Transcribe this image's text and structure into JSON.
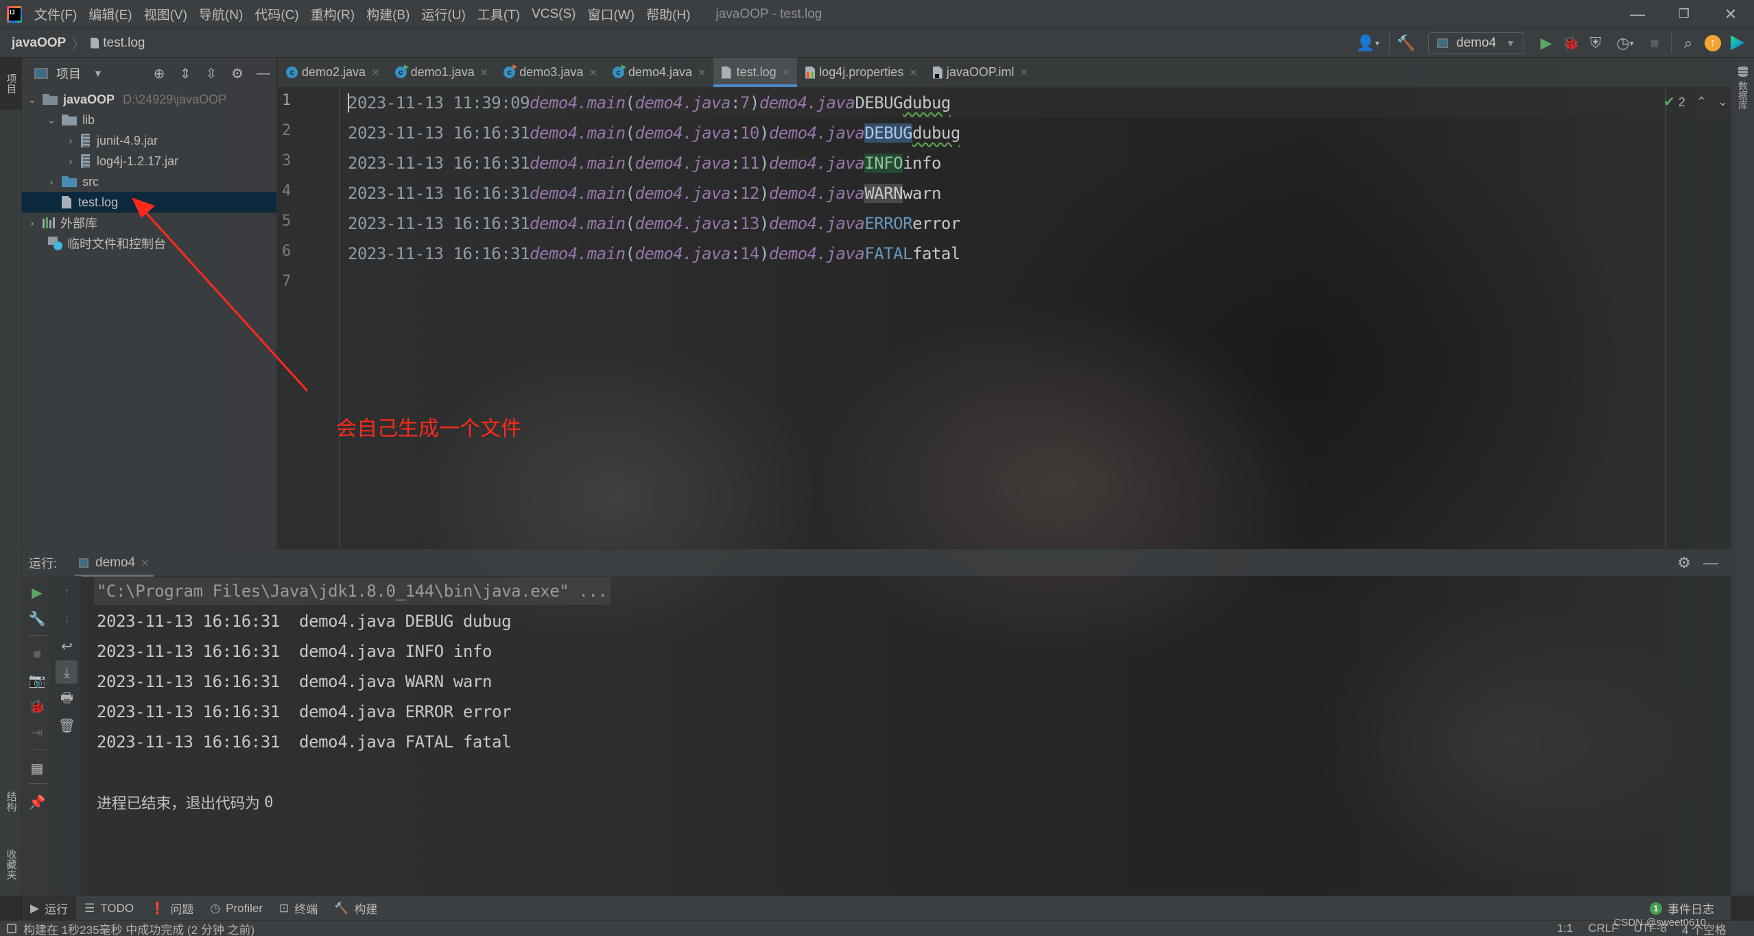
{
  "menubar": {
    "items": [
      "文件(F)",
      "编辑(E)",
      "视图(V)",
      "导航(N)",
      "代码(C)",
      "重构(R)",
      "构建(B)",
      "运行(U)",
      "工具(T)",
      "VCS(S)",
      "窗口(W)",
      "帮助(H)"
    ],
    "window_title": "javaOOP - test.log",
    "controls": {
      "minimize": "—",
      "restore": "❐",
      "close": "✕"
    }
  },
  "navbar": {
    "breadcrumb_root": "javaOOP",
    "breadcrumb_sep": "〉",
    "breadcrumb_file": "test.log",
    "run_config": "demo4",
    "icons": [
      "user-icon",
      "build-hammer-icon",
      "run-icon",
      "debug-icon",
      "coverage-icon",
      "profile-icon",
      "stop-icon",
      "search-icon",
      "update-icon",
      "toolbox-icon"
    ]
  },
  "left_strip": {
    "project_tab": "项目",
    "structure_tab": "结构",
    "favorites_tab": "收藏夹"
  },
  "right_strip": {
    "database_tab": "数据库"
  },
  "project_panel": {
    "title": "项目",
    "tree": [
      {
        "label": "javaOOP",
        "path": "D:\\24929\\javaOOP",
        "type": "module",
        "expanded": true,
        "level": 0
      },
      {
        "label": "lib",
        "type": "folder",
        "expanded": true,
        "level": 1
      },
      {
        "label": "junit-4.9.jar",
        "type": "jar",
        "expanded": false,
        "level": 2
      },
      {
        "label": "log4j-1.2.17.jar",
        "type": "jar",
        "expanded": false,
        "level": 2
      },
      {
        "label": "src",
        "type": "src-folder",
        "expanded": false,
        "level": 1
      },
      {
        "label": "test.log",
        "type": "log",
        "selected": true,
        "level": 1
      },
      {
        "label": "外部库",
        "type": "library",
        "expanded": false,
        "level": 0
      },
      {
        "label": "临时文件和控制台",
        "type": "scratch",
        "level": 0
      }
    ]
  },
  "editor_tabs": [
    {
      "label": "demo2.java",
      "icon": "class-icon",
      "active": false
    },
    {
      "label": "demo1.java",
      "icon": "class-run-icon",
      "active": false
    },
    {
      "label": "demo3.java",
      "icon": "class-error-icon",
      "active": false
    },
    {
      "label": "demo4.java",
      "icon": "class-run-icon",
      "active": false
    },
    {
      "label": "test.log",
      "icon": "log-file-icon",
      "active": true
    },
    {
      "label": "log4j.properties",
      "icon": "properties-file-icon",
      "active": false
    },
    {
      "label": "javaOOP.iml",
      "icon": "iml-file-icon",
      "active": false
    }
  ],
  "editor": {
    "inspection_count": "2",
    "lines": [
      {
        "num": "1",
        "date": "2023-11-13 11:39:09",
        "call": "demo4.main",
        "file": "demo4.java",
        "lineref": "7",
        "src": "demo4.java",
        "level": "DEBUG",
        "msg": "dubug"
      },
      {
        "num": "2",
        "date": "2023-11-13 16:16:31",
        "call": "demo4.main",
        "file": "demo4.java",
        "lineref": "10",
        "src": "demo4.java",
        "level": "DEBUG",
        "msg": "dubug"
      },
      {
        "num": "3",
        "date": "2023-11-13 16:16:31",
        "call": "demo4.main",
        "file": "demo4.java",
        "lineref": "11",
        "src": "demo4.java",
        "level": "INFO",
        "msg": "info"
      },
      {
        "num": "4",
        "date": "2023-11-13 16:16:31",
        "call": "demo4.main",
        "file": "demo4.java",
        "lineref": "12",
        "src": "demo4.java",
        "level": "WARN",
        "msg": "warn"
      },
      {
        "num": "5",
        "date": "2023-11-13 16:16:31",
        "call": "demo4.main",
        "file": "demo4.java",
        "lineref": "13",
        "src": "demo4.java",
        "level": "ERROR",
        "msg": "error"
      },
      {
        "num": "6",
        "date": "2023-11-13 16:16:31",
        "call": "demo4.main",
        "file": "demo4.java",
        "lineref": "14",
        "src": "demo4.java",
        "level": "FATAL",
        "msg": "fatal"
      },
      {
        "num": "7"
      }
    ]
  },
  "annotation": {
    "text": "会自己生成一个文件",
    "color": "#ff2a1a"
  },
  "run_window": {
    "label": "运行:",
    "tab": "demo4",
    "command": "\"C:\\Program Files\\Java\\jdk1.8.0_144\\bin\\java.exe\" ...",
    "output": [
      "2023-11-13 16:16:31  demo4.java DEBUG dubug",
      "2023-11-13 16:16:31  demo4.java INFO info",
      "2023-11-13 16:16:31  demo4.java WARN warn",
      "2023-11-13 16:16:31  demo4.java ERROR error",
      "2023-11-13 16:16:31  demo4.java FATAL fatal"
    ],
    "exit_text": "进程已结束，退出代码为 ",
    "exit_code": "0"
  },
  "bottom_tools": [
    {
      "label": "运行",
      "icon": "run-icon",
      "active": true
    },
    {
      "label": "TODO",
      "icon": "list-icon"
    },
    {
      "label": "问题",
      "icon": "problems-icon"
    },
    {
      "label": "Profiler",
      "icon": "profiler-icon"
    },
    {
      "label": "终端",
      "icon": "terminal-icon"
    },
    {
      "label": "构建",
      "icon": "build-hammer-icon"
    }
  ],
  "event_log": {
    "count": "1",
    "label": "事件日志"
  },
  "statusbar": {
    "message": "构建在 1秒235毫秒 中成功完成 (2 分钟 之前)",
    "position": "1:1",
    "line_ending": "CRLF",
    "encoding": "UTF-8",
    "indent": "4 个空格"
  },
  "watermark": "CSDN @sweet0610",
  "colors": {
    "accent": "#4a88c7",
    "selection": "#0d293e",
    "run_green": "#59a869",
    "keyword_purple": "#9876aa",
    "number_blue": "#6897bb"
  }
}
